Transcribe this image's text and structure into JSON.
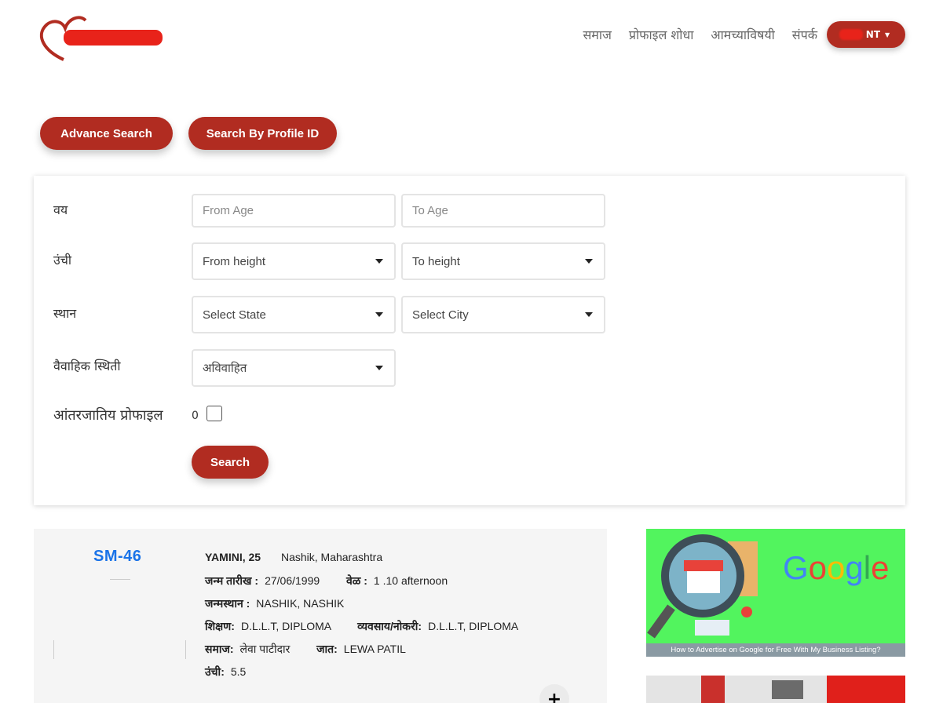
{
  "nav": {
    "items": [
      "समाज",
      "प्रोफाइल शोधा",
      "आमच्याविषयी",
      "संपर्क"
    ],
    "account_label": "NT"
  },
  "search_tabs": {
    "advance": "Advance Search",
    "profile_id": "Search By Profile ID"
  },
  "form": {
    "age_label": "वय",
    "from_age_placeholder": "From Age",
    "to_age_placeholder": "To Age",
    "height_label": "उंची",
    "from_height": "From height",
    "to_height": "To height",
    "place_label": "स्थान",
    "state": "Select State",
    "city": "Select City",
    "marital_label": "वैवाहिक स्थिती",
    "marital_value": "अविवाहित",
    "intercaste_label": "आंतरजातिय प्रोफाइल",
    "intercaste_count": "0",
    "search_button": "Search"
  },
  "result": {
    "profile_id": "SM-46",
    "name_age": "YAMINI, 25",
    "location": "Nashik, Maharashtra",
    "dob_label": "जन्म तारीख :",
    "dob": "27/06/1999",
    "time_label": "वेळ :",
    "time": "1 .10 afternoon",
    "birthplace_label": "जन्मस्थान :",
    "birthplace": "NASHIK, NASHIK",
    "education_label": "शिक्षण:",
    "education": "D.L.L.T, DIPLOMA",
    "occupation_label": "व्यवसाय/नोकरी:",
    "occupation": "D.L.L.T, DIPLOMA",
    "community_label": "समाज:",
    "community": "लेवा पाटीदार",
    "caste_label": "जात:",
    "caste": "LEWA PATIL",
    "height_label": "उंची:",
    "height": "5.5",
    "expand": "+"
  },
  "ads": {
    "ad1_caption": "How to Advertise on Google for Free With My Business Listing?",
    "ad1_brand": "Google"
  },
  "colors": {
    "brand": "#b12c21",
    "link": "#1a73e8",
    "ad_bg": "#52f45e"
  }
}
